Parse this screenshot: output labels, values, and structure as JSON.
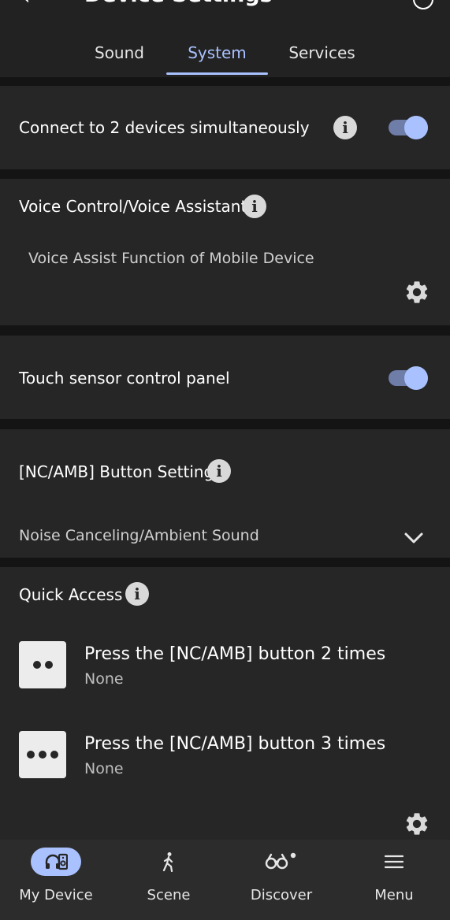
{
  "header": {
    "title": "Device Settings",
    "back_icon": "back-arrow-icon",
    "help_icon": "help-circle-icon"
  },
  "tabs": [
    {
      "label": "Sound",
      "active": false
    },
    {
      "label": "System",
      "active": true
    },
    {
      "label": "Services",
      "active": false
    }
  ],
  "connect_two": {
    "label": "Connect to 2 devices simultaneously",
    "enabled": true
  },
  "voice_control": {
    "title": "Voice Control/Voice Assistant",
    "value": "Voice Assist Function of Mobile Device"
  },
  "touch_sensor": {
    "label": "Touch sensor control panel",
    "enabled": true
  },
  "nc_amb": {
    "title": "[NC/AMB] Button Setting",
    "selected": "Noise Canceling/Ambient Sound"
  },
  "quick_access": {
    "title": "Quick Access",
    "items": [
      {
        "title": "Press the [NC/AMB] button 2 times",
        "value": "None",
        "dots": 2
      },
      {
        "title": "Press the [NC/AMB] button 3 times",
        "value": "None",
        "dots": 3
      }
    ]
  },
  "bottom_nav": [
    {
      "label": "My Device",
      "icon": "headphones-speaker-icon",
      "active": true
    },
    {
      "label": "Scene",
      "icon": "walking-person-icon",
      "active": false
    },
    {
      "label": "Discover",
      "icon": "binoculars-icon",
      "active": false
    },
    {
      "label": "Menu",
      "icon": "hamburger-menu-icon",
      "active": false
    }
  ],
  "colors": {
    "accent": "#a9c1ff",
    "background": "#141414",
    "card": "#262626"
  }
}
